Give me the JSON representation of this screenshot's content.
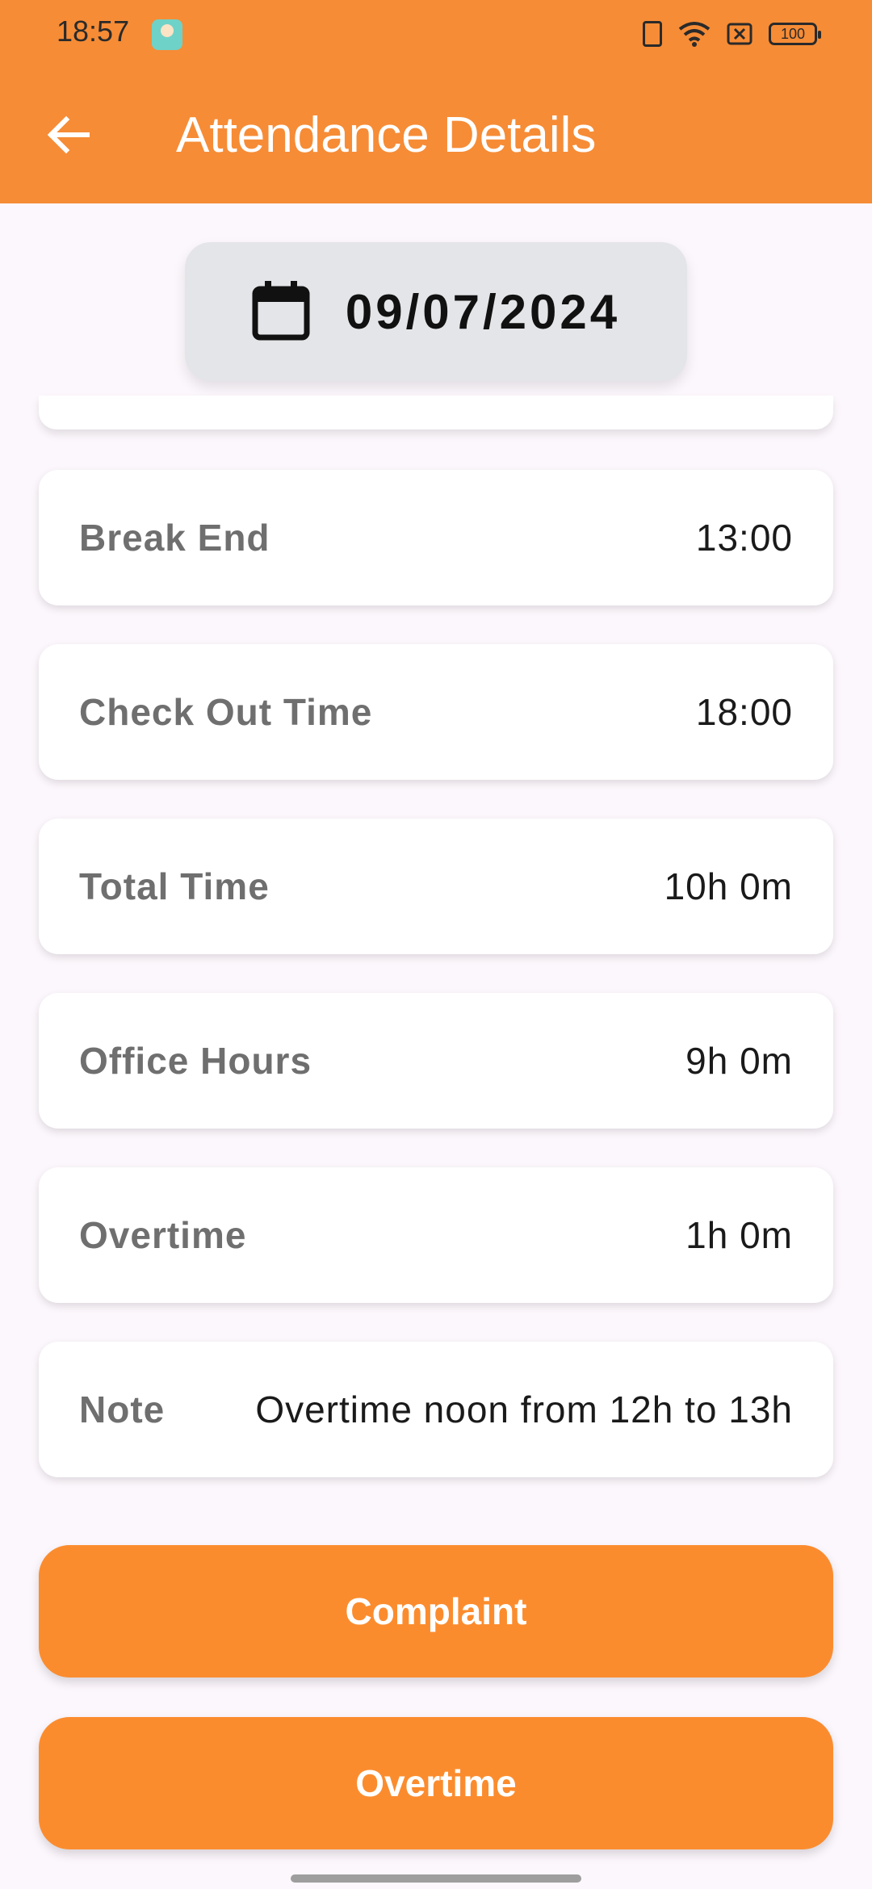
{
  "status_bar": {
    "time": "18:57",
    "battery": "100"
  },
  "app_bar": {
    "title": "Attendance Details"
  },
  "date_picker": {
    "date": "09/07/2024"
  },
  "rows": [
    {
      "label": "Break End",
      "value": "13:00"
    },
    {
      "label": "Check Out Time",
      "value": "18:00"
    },
    {
      "label": "Total Time",
      "value": "10h 0m"
    },
    {
      "label": "Office Hours",
      "value": "9h 0m"
    },
    {
      "label": "Overtime",
      "value": "1h 0m"
    },
    {
      "label": "Note",
      "value": "Overtime noon from 12h to 13h"
    }
  ],
  "buttons": {
    "complaint": "Complaint",
    "overtime": "Overtime"
  },
  "colors": {
    "accent": "#f68c36",
    "button": "#fb8c2e",
    "background": "#fcf7fc",
    "date_chip": "#e4e5e8"
  }
}
